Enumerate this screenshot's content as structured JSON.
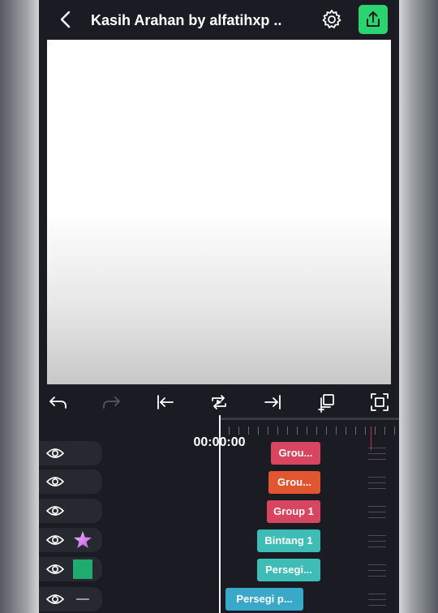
{
  "header": {
    "title": "Kasih Arahan by alfatihxp ..",
    "back_icon": "chevron-left-icon",
    "settings_icon": "gear-icon",
    "export_icon": "share-upload-icon",
    "export_color": "#2bd46e"
  },
  "toolbar": {
    "items": [
      "undo-icon",
      "redo-icon",
      "jump-to-start-icon",
      "loop-icon",
      "jump-to-end-icon",
      "duplicate-add-icon",
      "fit-screen-icon"
    ]
  },
  "timeline": {
    "timecode": "00:00:00",
    "playhead_color": "#f5f5f5",
    "marker_color": "#c7354a"
  },
  "layers": [
    {
      "thumb": "none",
      "clip_label": "Grou...",
      "clip_color": "#d8455e"
    },
    {
      "thumb": "none",
      "clip_label": "Grou...",
      "clip_color": "#e2552f"
    },
    {
      "thumb": "none",
      "clip_label": "Group 1",
      "clip_color": "#d8455e"
    },
    {
      "thumb": "star-icon",
      "clip_label": "Bintang 1",
      "clip_color": "#3ebdb7"
    },
    {
      "thumb": "green-square",
      "thumb_color": "#1faa6f",
      "clip_label": "Persegi...",
      "clip_color": "#3ebdb7"
    },
    {
      "thumb": "line-icon",
      "clip_label": "Persegi p...",
      "clip_color": "#3aa8c9"
    }
  ]
}
